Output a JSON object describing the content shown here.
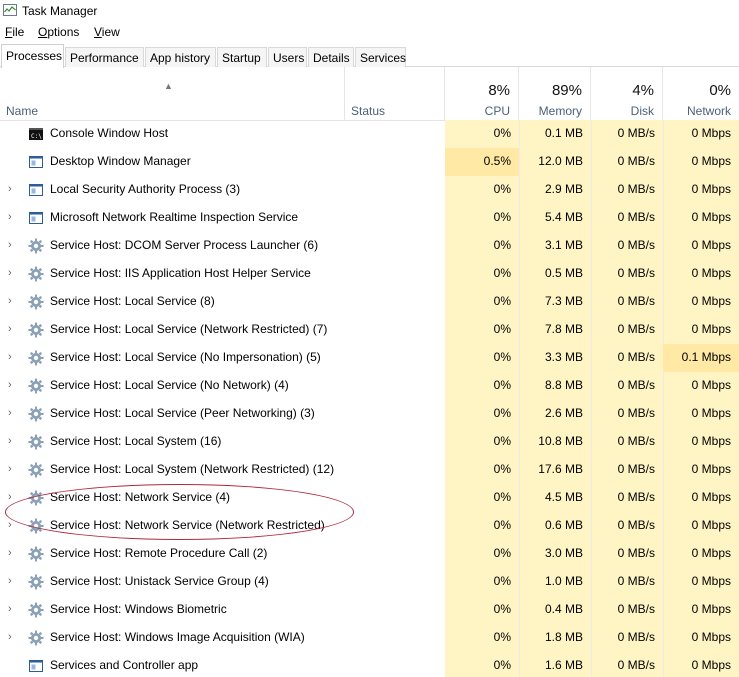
{
  "window": {
    "title": "Task Manager",
    "icon": "task-manager-icon"
  },
  "menu": [
    {
      "underline": "F",
      "rest": "ile"
    },
    {
      "underline": "O",
      "rest": "ptions"
    },
    {
      "underline": "V",
      "rest": "iew"
    }
  ],
  "tabs": [
    "Processes",
    "Performance",
    "App history",
    "Startup",
    "Users",
    "Details",
    "Services"
  ],
  "active_tab": "Processes",
  "columns": {
    "name": {
      "label": "Name"
    },
    "status": {
      "label": "Status"
    },
    "cpu": {
      "pct": "8%",
      "label": "CPU"
    },
    "memory": {
      "pct": "89%",
      "label": "Memory"
    },
    "disk": {
      "pct": "4%",
      "label": "Disk"
    },
    "network": {
      "pct": "0%",
      "label": "Network"
    }
  },
  "processes": [
    {
      "name": "Console Window Host",
      "icon": "console-icon",
      "expandable": false,
      "cpu": "0%",
      "memory": "0.1 MB",
      "disk": "0 MB/s",
      "network": "0 Mbps"
    },
    {
      "name": "Desktop Window Manager",
      "icon": "window-icon",
      "expandable": false,
      "cpu": "0.5%",
      "memory": "12.0 MB",
      "disk": "0 MB/s",
      "network": "0 Mbps",
      "cpu_hl": true
    },
    {
      "name": "Local Security Authority Process (3)",
      "icon": "window-icon",
      "expandable": true,
      "cpu": "0%",
      "memory": "2.9 MB",
      "disk": "0 MB/s",
      "network": "0 Mbps"
    },
    {
      "name": "Microsoft Network Realtime Inspection Service",
      "icon": "window-icon",
      "expandable": true,
      "cpu": "0%",
      "memory": "5.4 MB",
      "disk": "0 MB/s",
      "network": "0 Mbps"
    },
    {
      "name": "Service Host: DCOM Server Process Launcher (6)",
      "icon": "gear-icon",
      "expandable": true,
      "cpu": "0%",
      "memory": "3.1 MB",
      "disk": "0 MB/s",
      "network": "0 Mbps"
    },
    {
      "name": "Service Host: IIS Application Host Helper Service",
      "icon": "gear-icon",
      "expandable": true,
      "cpu": "0%",
      "memory": "0.5 MB",
      "disk": "0 MB/s",
      "network": "0 Mbps"
    },
    {
      "name": "Service Host: Local Service (8)",
      "icon": "gear-icon",
      "expandable": true,
      "cpu": "0%",
      "memory": "7.3 MB",
      "disk": "0 MB/s",
      "network": "0 Mbps"
    },
    {
      "name": "Service Host: Local Service (Network Restricted) (7)",
      "icon": "gear-icon",
      "expandable": true,
      "cpu": "0%",
      "memory": "7.8 MB",
      "disk": "0 MB/s",
      "network": "0 Mbps"
    },
    {
      "name": "Service Host: Local Service (No Impersonation) (5)",
      "icon": "gear-icon",
      "expandable": true,
      "cpu": "0%",
      "memory": "3.3 MB",
      "disk": "0 MB/s",
      "network": "0.1 Mbps",
      "net_hl": true
    },
    {
      "name": "Service Host: Local Service (No Network) (4)",
      "icon": "gear-icon",
      "expandable": true,
      "cpu": "0%",
      "memory": "8.8 MB",
      "disk": "0 MB/s",
      "network": "0 Mbps"
    },
    {
      "name": "Service Host: Local Service (Peer Networking) (3)",
      "icon": "gear-icon",
      "expandable": true,
      "cpu": "0%",
      "memory": "2.6 MB",
      "disk": "0 MB/s",
      "network": "0 Mbps"
    },
    {
      "name": "Service Host: Local System (16)",
      "icon": "gear-icon",
      "expandable": true,
      "cpu": "0%",
      "memory": "10.8 MB",
      "disk": "0 MB/s",
      "network": "0 Mbps"
    },
    {
      "name": "Service Host: Local System (Network Restricted) (12)",
      "icon": "gear-icon",
      "expandable": true,
      "cpu": "0%",
      "memory": "17.6 MB",
      "disk": "0 MB/s",
      "network": "0 Mbps"
    },
    {
      "name": "Service Host: Network Service (4)",
      "icon": "gear-icon",
      "expandable": true,
      "cpu": "0%",
      "memory": "4.5 MB",
      "disk": "0 MB/s",
      "network": "0 Mbps"
    },
    {
      "name": "Service Host: Network Service (Network Restricted)",
      "icon": "gear-icon",
      "expandable": true,
      "cpu": "0%",
      "memory": "0.6 MB",
      "disk": "0 MB/s",
      "network": "0 Mbps"
    },
    {
      "name": "Service Host: Remote Procedure Call (2)",
      "icon": "gear-icon",
      "expandable": true,
      "cpu": "0%",
      "memory": "3.0 MB",
      "disk": "0 MB/s",
      "network": "0 Mbps"
    },
    {
      "name": "Service Host: Unistack Service Group (4)",
      "icon": "gear-icon",
      "expandable": true,
      "cpu": "0%",
      "memory": "1.0 MB",
      "disk": "0 MB/s",
      "network": "0 Mbps"
    },
    {
      "name": "Service Host: Windows Biometric",
      "icon": "gear-icon",
      "expandable": true,
      "cpu": "0%",
      "memory": "0.4 MB",
      "disk": "0 MB/s",
      "network": "0 Mbps"
    },
    {
      "name": "Service Host: Windows Image Acquisition (WIA)",
      "icon": "gear-icon",
      "expandable": true,
      "cpu": "0%",
      "memory": "1.8 MB",
      "disk": "0 MB/s",
      "network": "0 Mbps"
    },
    {
      "name": "Services and Controller app",
      "icon": "window-icon",
      "expandable": false,
      "cpu": "0%",
      "memory": "1.6 MB",
      "disk": "0 MB/s",
      "network": "0 Mbps"
    }
  ],
  "colors": {
    "usage_bg": "#fff4c4",
    "usage_highlight": "#ffe9a4",
    "annotation": "#b0283c",
    "header_label": "#4c607a"
  }
}
